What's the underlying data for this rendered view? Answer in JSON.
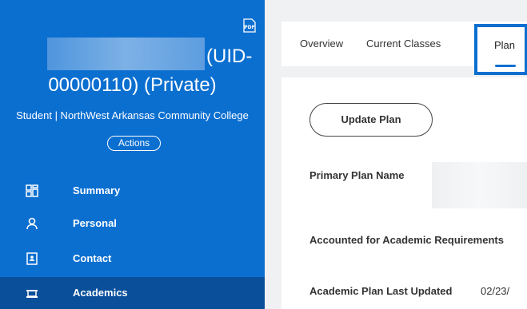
{
  "sidebar": {
    "uid_line1": "(UID-",
    "uid_line2": "00000110) (Private)",
    "student_line": "Student | NorthWest Arkansas Community College",
    "actions_label": "Actions",
    "pdf_icon": "pdf-icon",
    "items": [
      {
        "label": "Summary",
        "icon": "summary-grid-icon"
      },
      {
        "label": "Personal",
        "icon": "person-icon"
      },
      {
        "label": "Contact",
        "icon": "contact-card-icon"
      },
      {
        "label": "Academics",
        "icon": "academics-icon",
        "active": true
      }
    ]
  },
  "tabs": {
    "items": [
      "Overview",
      "Current Classes",
      "Plan"
    ],
    "active": "Plan"
  },
  "content": {
    "update_plan_label": "Update Plan",
    "fields": {
      "primary_plan_name": "Primary Plan Name",
      "accounted_for": "Accounted for Academic Requirements",
      "last_updated_label": "Academic Plan Last Updated",
      "last_updated_value": "02/23/"
    }
  },
  "colors": {
    "sidebar_bg": "#0b6fd0",
    "sidebar_active_bg": "#0a4f9a",
    "accent": "#0b6fd0"
  }
}
